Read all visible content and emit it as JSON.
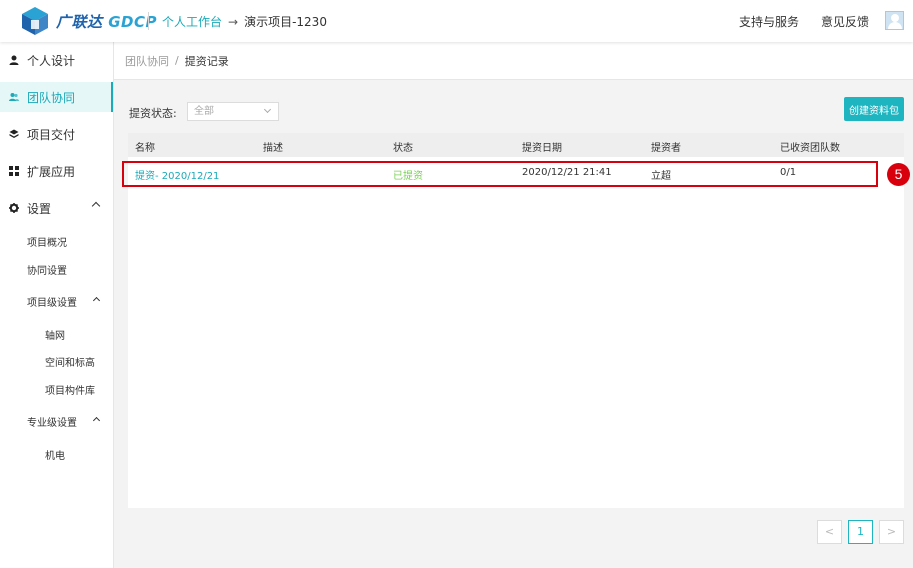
{
  "header": {
    "logo_brand": "广联达",
    "logo_product": "GDCP",
    "workspace_link": "个人工作台",
    "project_name": "演示项目-1230",
    "support_label": "支持与服务",
    "feedback_label": "意见反馈"
  },
  "sidebar": {
    "items": [
      {
        "label": "个人设计",
        "icon": "user-icon"
      },
      {
        "label": "团队协同",
        "icon": "team-icon"
      },
      {
        "label": "项目交付",
        "icon": "layers-icon"
      },
      {
        "label": "扩展应用",
        "icon": "grid-icon"
      },
      {
        "label": "设置",
        "icon": "gear-icon"
      }
    ],
    "settings_sub": {
      "overview": "项目概况",
      "collab": "协同设置",
      "project_level": "项目级设置",
      "grid": "轴网",
      "space": "空间和标高",
      "library": "项目构件库",
      "discipline_level": "专业级设置",
      "mep": "机电"
    }
  },
  "breadcrumb": {
    "parent": "团队协同",
    "separator": "/",
    "current": "提资记录"
  },
  "filter": {
    "label": "提资状态:",
    "selected": "全部"
  },
  "create_button_label": "创建资料包",
  "table": {
    "headers": [
      "名称",
      "描述",
      "状态",
      "提资日期",
      "提资者",
      "已收资团队数"
    ],
    "rows": [
      {
        "name": "提资- 2020/12/21",
        "description": "",
        "status": "已提资",
        "date": "2020/12/21 21:41",
        "submitter": "立超",
        "received": "0/1"
      }
    ]
  },
  "annotation_badge": "5",
  "pagination": {
    "prev": "<",
    "current_page": "1",
    "next": ">"
  },
  "colors": {
    "accent": "#1fb5c0",
    "status_ok": "#7ad057",
    "annotation": "#d9000d",
    "brand": "#1f63ad"
  }
}
